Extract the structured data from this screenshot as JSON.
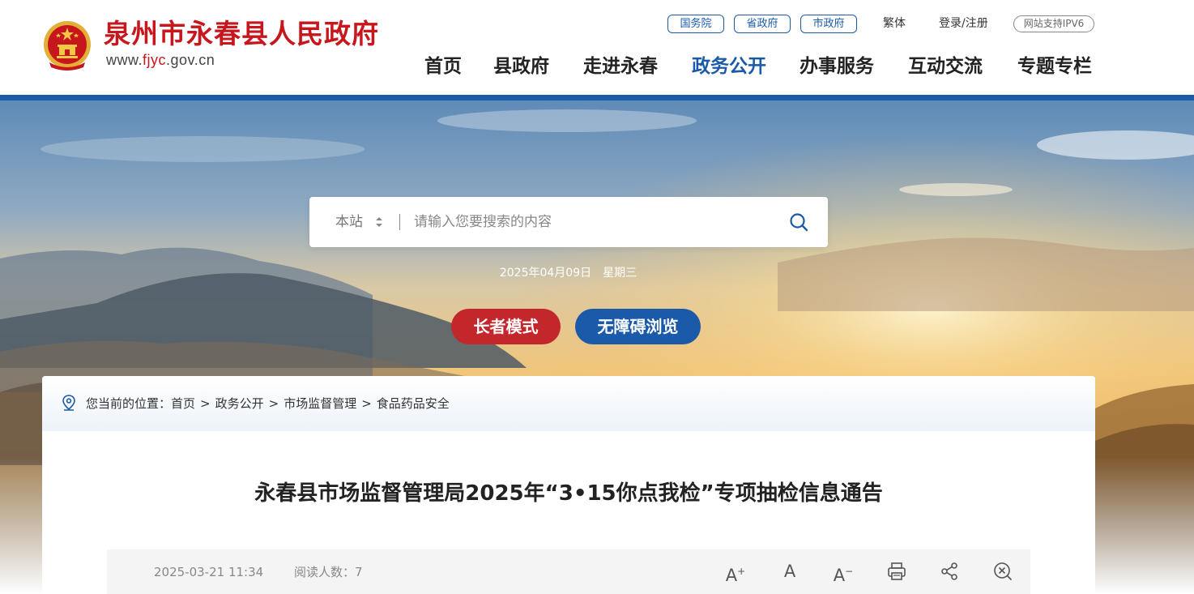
{
  "header": {
    "site_title": "泉州市永春县人民政府",
    "site_url_pre": "www.",
    "site_url_highlight": "fjyc",
    "site_url_post": ".gov.cn",
    "top_links": {
      "state_council": "国务院",
      "province_gov": "省政府",
      "city_gov": "市政府",
      "traditional": "繁体",
      "login": "登录/注册",
      "ipv6": "网站支持IPV6"
    },
    "nav": [
      "首页",
      "县政府",
      "走进永春",
      "政务公开",
      "办事服务",
      "互动交流",
      "专题专栏"
    ],
    "active_nav": "政务公开"
  },
  "search": {
    "scope": "本站",
    "placeholder": "请输入您要搜索的内容"
  },
  "date": {
    "date": "2025年04月09日",
    "weekday": "星期三"
  },
  "modes": {
    "elder": "长者模式",
    "accessible": "无障碍浏览"
  },
  "breadcrumb": {
    "prefix": "您当前的位置：",
    "items": [
      "首页",
      "政务公开",
      "市场监督管理",
      "食品药品安全"
    ],
    "sep": ">"
  },
  "article": {
    "title": "永春县市场监督管理局2025年“3•15你点我检”专项抽检信息通告",
    "publish_time": "2025-03-21 11:34",
    "reads_label": "阅读人数：",
    "reads": "7"
  },
  "tools": [
    "font-increase-icon",
    "font-normal-icon",
    "font-decrease-icon",
    "print-icon",
    "share-icon",
    "close-icon"
  ],
  "colors": {
    "brand_blue": "#1b5aa8",
    "brand_red": "#c8161d",
    "elder_red": "#c3262b"
  }
}
